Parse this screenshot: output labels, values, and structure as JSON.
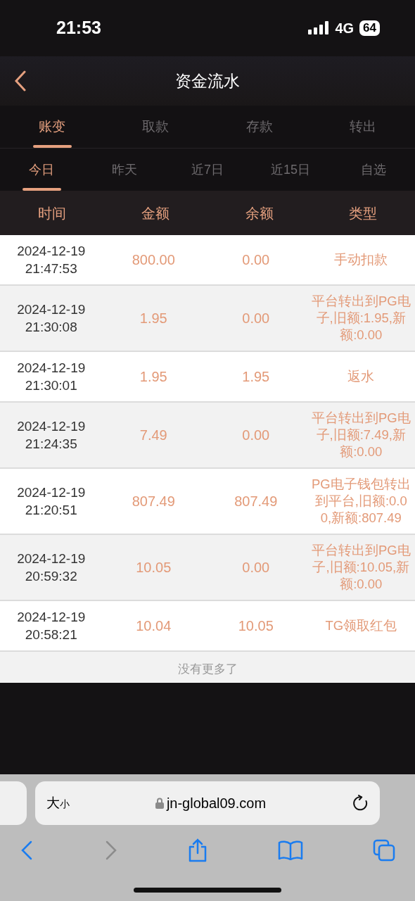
{
  "status_bar": {
    "time": "21:53",
    "network": "4G",
    "battery": "64"
  },
  "header": {
    "title": "资金流水"
  },
  "tabs": [
    {
      "label": "账变",
      "selected": true
    },
    {
      "label": "取款",
      "selected": false
    },
    {
      "label": "存款",
      "selected": false
    },
    {
      "label": "转出",
      "selected": false
    }
  ],
  "periods": [
    {
      "label": "今日",
      "selected": true
    },
    {
      "label": "昨天",
      "selected": false
    },
    {
      "label": "近7日",
      "selected": false
    },
    {
      "label": "近15日",
      "selected": false
    },
    {
      "label": "自选",
      "selected": false
    }
  ],
  "table": {
    "columns": [
      "时间",
      "金额",
      "余额",
      "类型"
    ],
    "rows": [
      {
        "date": "2024-12-19",
        "time": "21:47:53",
        "amount": "800.00",
        "balance": "0.00",
        "type": "手动扣款"
      },
      {
        "date": "2024-12-19",
        "time": "21:30:08",
        "amount": "1.95",
        "balance": "0.00",
        "type": "平台转出到PG电子,旧额:1.95,新额:0.00"
      },
      {
        "date": "2024-12-19",
        "time": "21:30:01",
        "amount": "1.95",
        "balance": "1.95",
        "type": "返水"
      },
      {
        "date": "2024-12-19",
        "time": "21:24:35",
        "amount": "7.49",
        "balance": "0.00",
        "type": "平台转出到PG电子,旧额:7.49,新额:0.00"
      },
      {
        "date": "2024-12-19",
        "time": "21:20:51",
        "amount": "807.49",
        "balance": "807.49",
        "type": "PG电子钱包转出到平台,旧额:0.00,新额:807.49"
      },
      {
        "date": "2024-12-19",
        "time": "20:59:32",
        "amount": "10.05",
        "balance": "0.00",
        "type": "平台转出到PG电子,旧额:10.05,新额:0.00"
      },
      {
        "date": "2024-12-19",
        "time": "20:58:21",
        "amount": "10.04",
        "balance": "10.05",
        "type": "TG领取红包"
      }
    ],
    "footer": "没有更多了"
  },
  "browser": {
    "text_size_big": "大",
    "text_size_small": "小",
    "url": "jn-global09.com"
  }
}
